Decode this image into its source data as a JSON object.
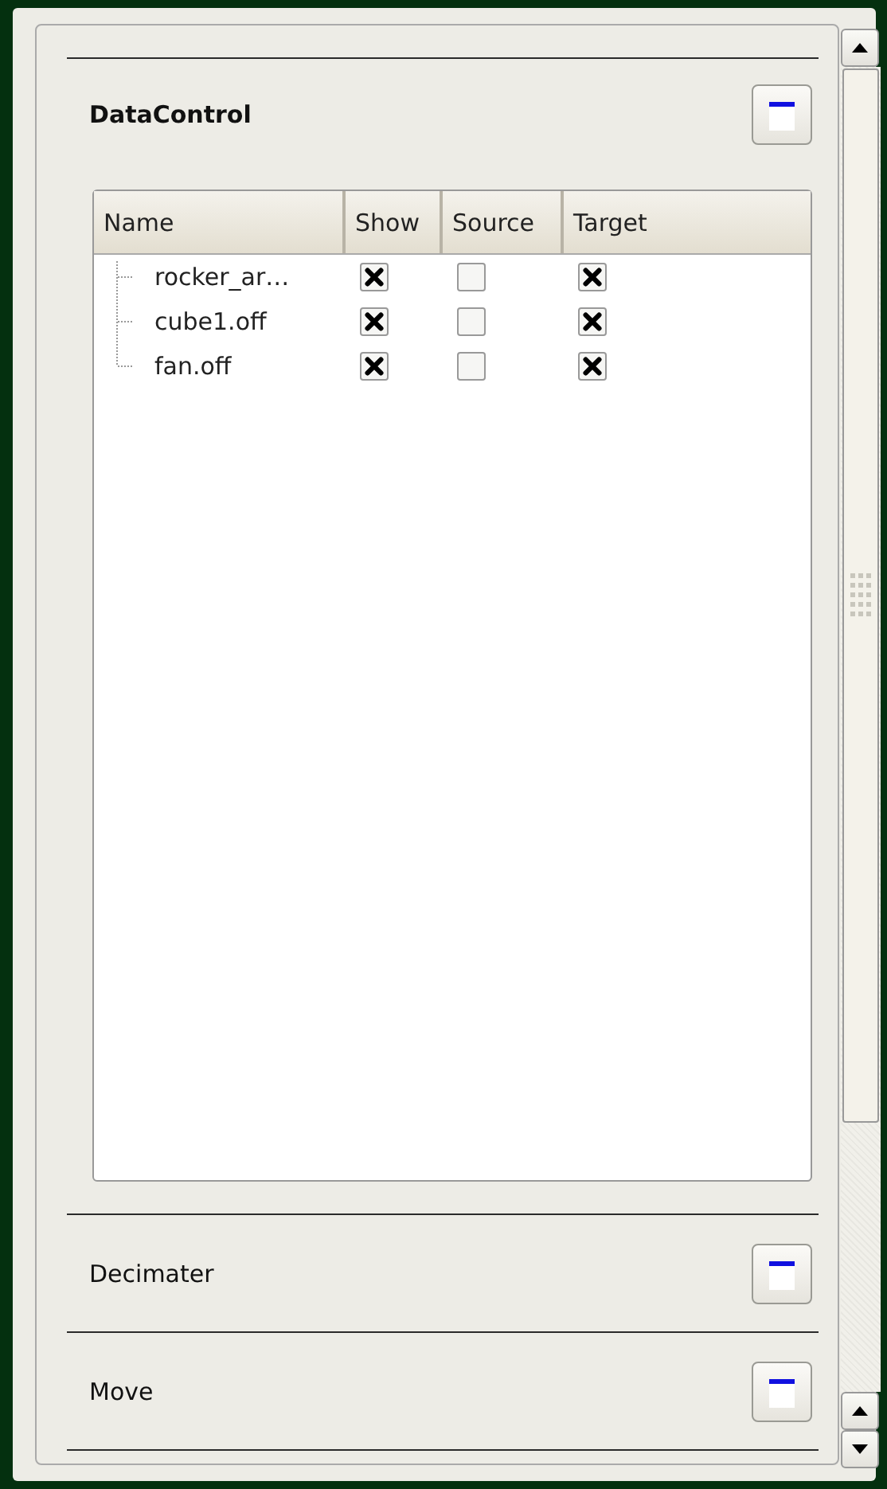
{
  "sections": [
    {
      "title": "DataControl",
      "expanded": true,
      "table": {
        "columns": [
          "Name",
          "Show",
          "Source",
          "Target"
        ],
        "rows": [
          {
            "name": "rocker_ar…",
            "show": true,
            "source": false,
            "target": true
          },
          {
            "name": "cube1.off",
            "show": true,
            "source": false,
            "target": true
          },
          {
            "name": "fan.off",
            "show": true,
            "source": false,
            "target": true
          }
        ]
      }
    },
    {
      "title": "Decimater",
      "expanded": false
    },
    {
      "title": "Move",
      "expanded": false
    }
  ]
}
